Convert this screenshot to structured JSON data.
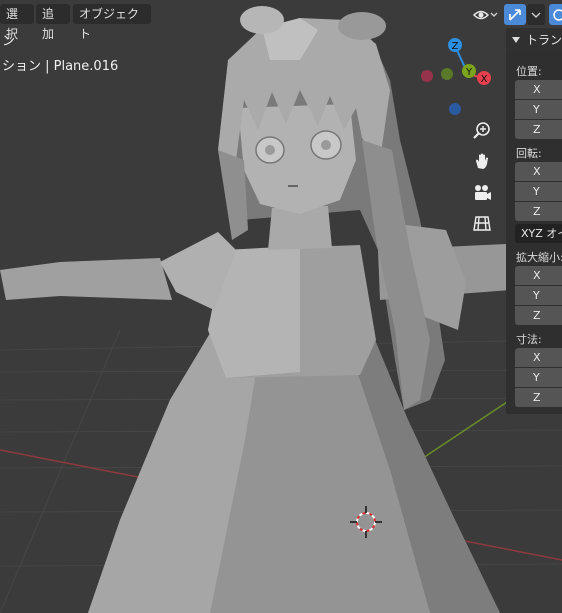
{
  "header": {
    "menu": [
      "選択",
      "追加",
      "オブジェクト"
    ]
  },
  "viewport": {
    "info_text": "ション | Plane.016"
  },
  "gizmo": {
    "z": "Z",
    "y": "Y",
    "x": "X",
    "colors": {
      "x": "#e5404d",
      "y": "#7ba31c",
      "z": "#2c8fe2"
    }
  },
  "nav_icons": [
    "zoom-icon",
    "hand-icon",
    "camera-icon",
    "grid-icon"
  ],
  "npanel": {
    "title": "トラン",
    "location_label": "位置:",
    "rotation_label": "回転:",
    "rotation_mode": "XYZ オイ",
    "scale_label": "拡大縮小:",
    "dimensions_label": "寸法:",
    "axes": [
      "X",
      "Y",
      "Z"
    ]
  },
  "colors": {
    "viewport_bg": "#3b3b3b",
    "panel_bg": "#2f2f2f",
    "field_bg": "#555555",
    "accent": "#4b8ad8"
  }
}
